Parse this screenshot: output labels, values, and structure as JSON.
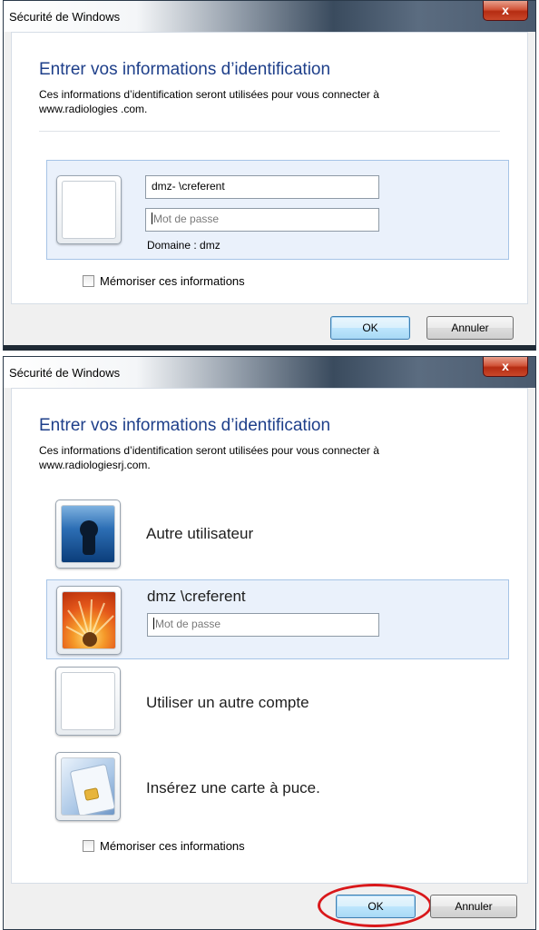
{
  "dialog1": {
    "title": "Sécurité de Windows",
    "close_label": "x",
    "heading": "Entrer vos informations d’identification",
    "desc_line1": "Ces informations d’identification seront utilisées pour vous connecter à",
    "desc_line2": "www.radiologies  .com.",
    "username_value": "dmz-   \\creferent",
    "password_placeholder": "Mot de passe",
    "domain_label": "Domaine : dmz",
    "remember_label": "Mémoriser ces informations",
    "ok_label": "OK",
    "cancel_label": "Annuler"
  },
  "dialog2": {
    "title": "Sécurité de Windows",
    "close_label": "x",
    "heading": "Entrer vos informations d’identification",
    "desc_line1": "Ces informations d’identification seront utilisées pour vous connecter à",
    "desc_line2": "www.radiologiesrj.com.",
    "tiles": {
      "other_user": "Autre utilisateur",
      "account_name": "dmz   \\creferent",
      "password_placeholder": "Mot de passe",
      "other_account": "Utiliser un autre compte",
      "smartcard": "Insérez une carte à puce."
    },
    "remember_label": "Mémoriser ces informations",
    "ok_label": "OK",
    "cancel_label": "Annuler"
  },
  "colors": {
    "heading_blue": "#1e3f8a",
    "selection_bg": "#eaf1fb",
    "selection_border": "#a6c4e6",
    "highlight_ring": "#d9181b"
  }
}
